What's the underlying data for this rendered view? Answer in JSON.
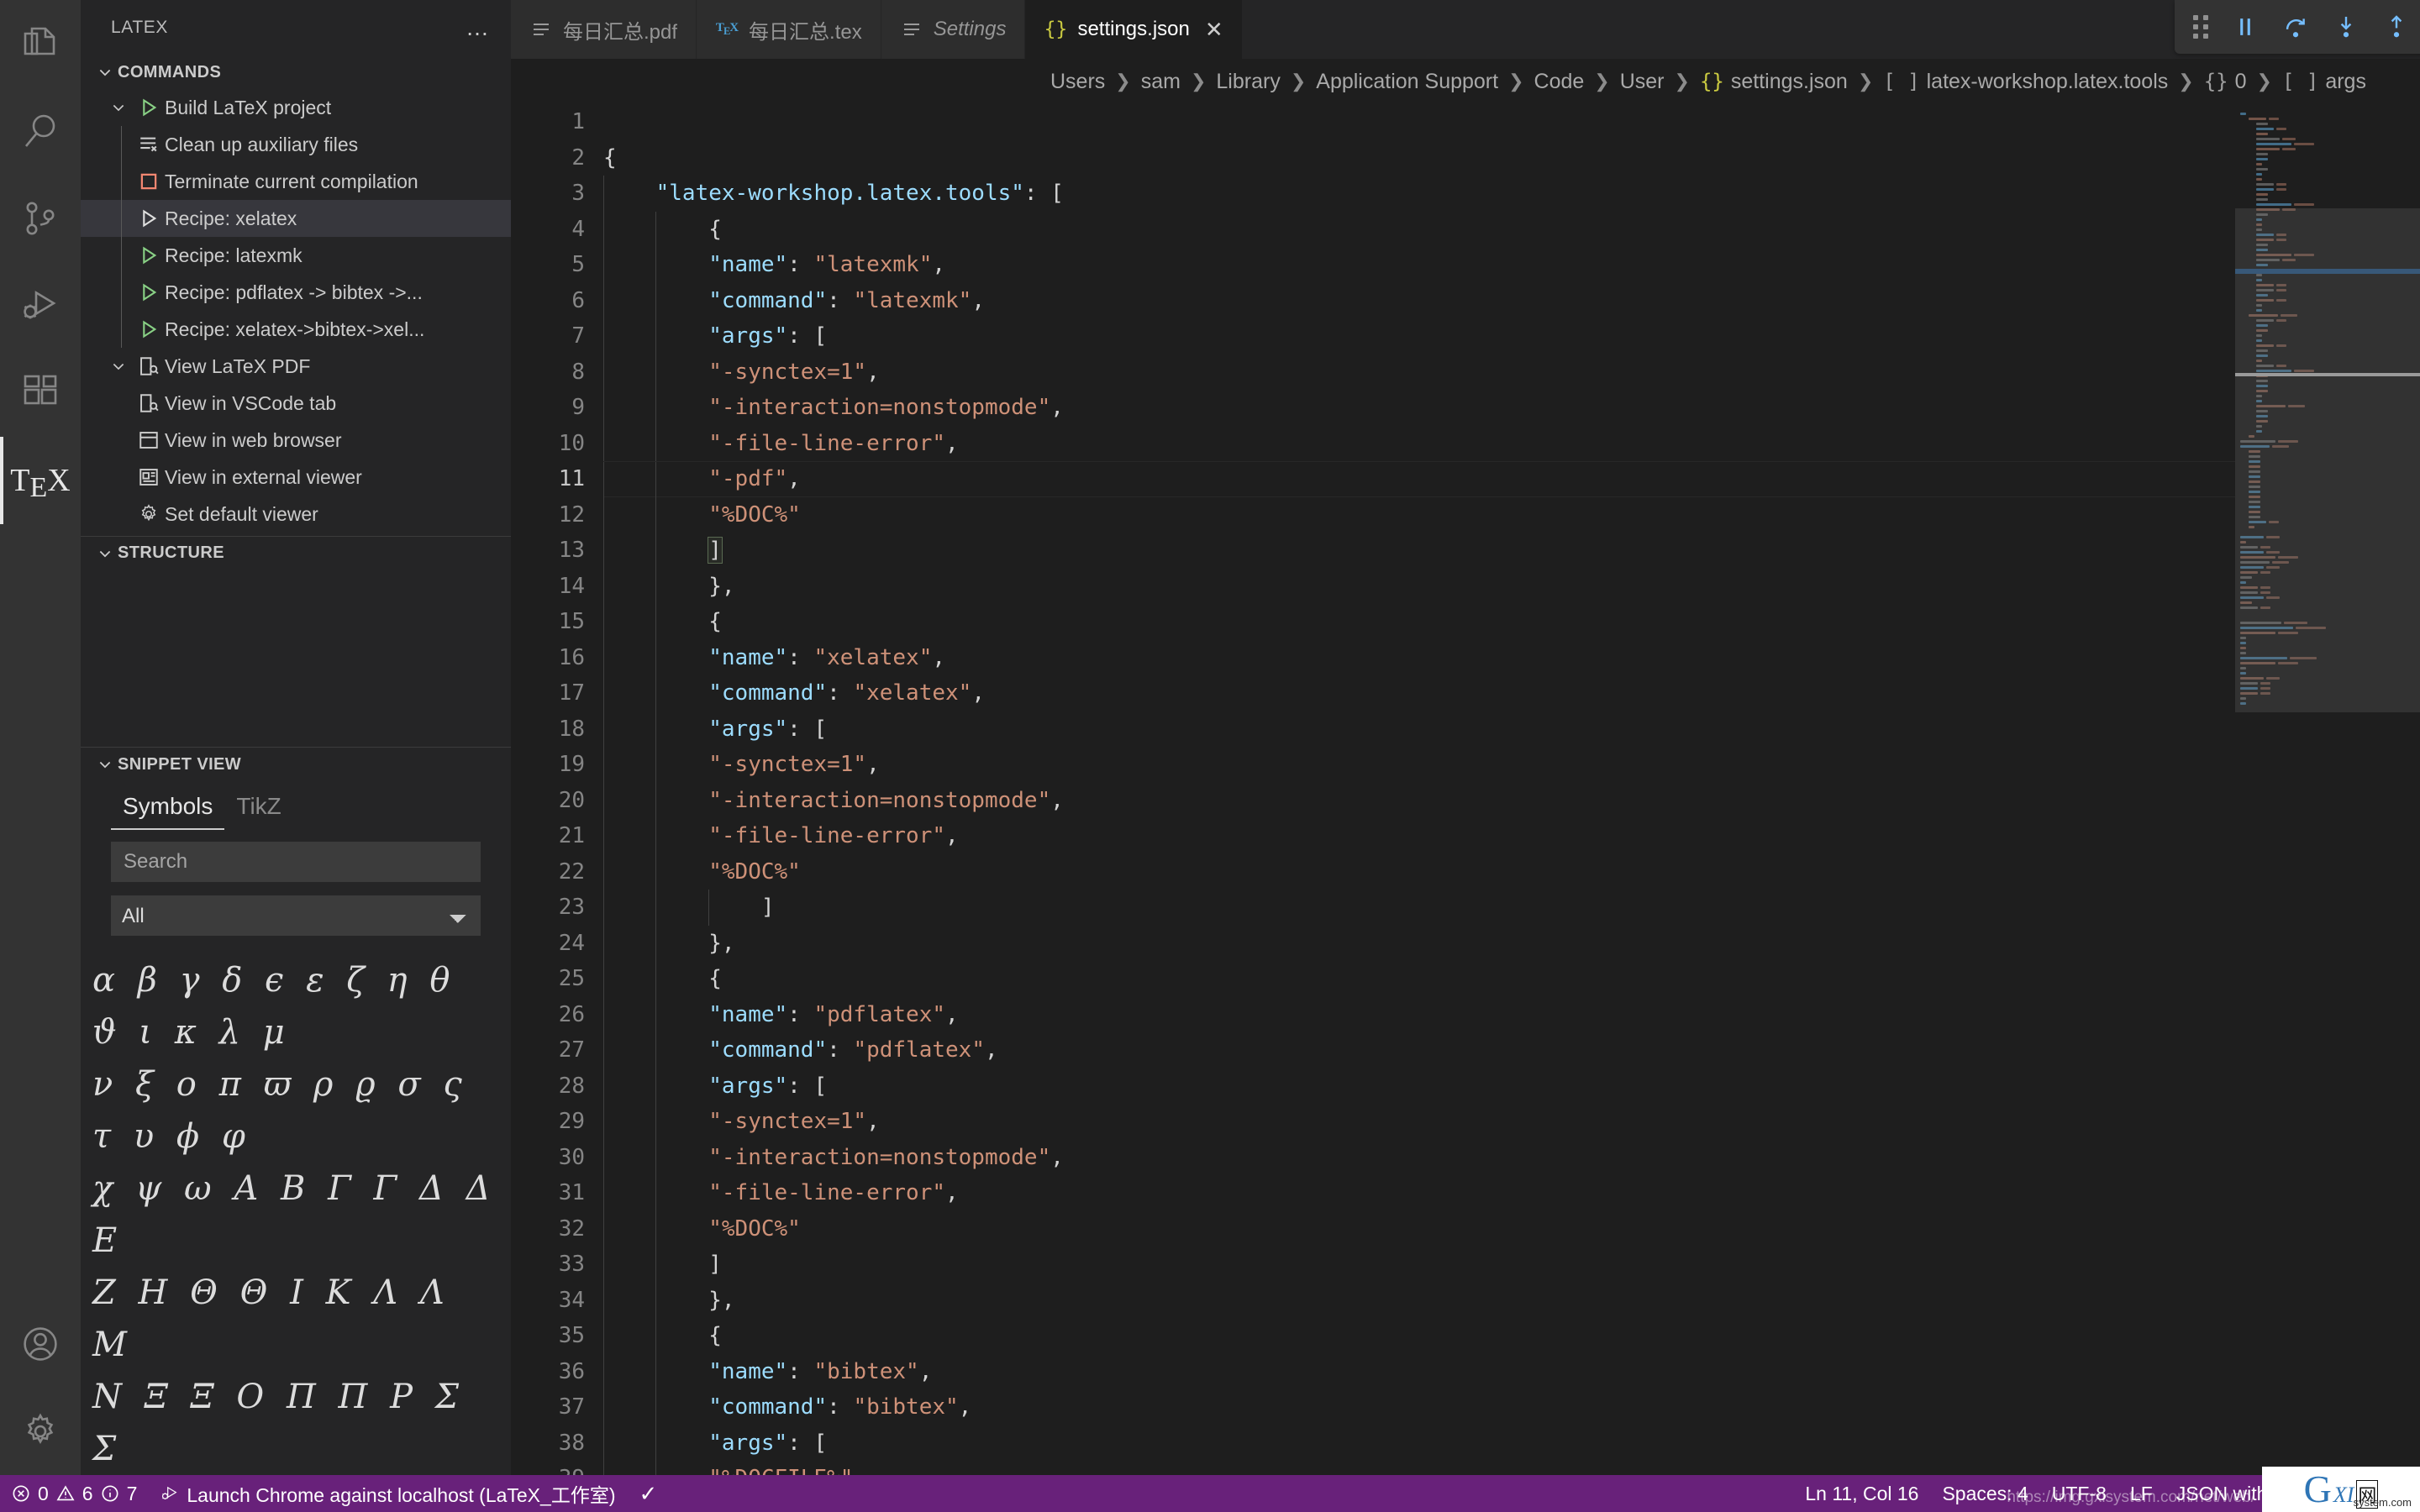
{
  "activity_bar": {
    "items": [
      {
        "name": "explorer",
        "icon": "files-icon",
        "active": false
      },
      {
        "name": "search",
        "icon": "search-icon",
        "active": false
      },
      {
        "name": "source-control",
        "icon": "source-control-icon",
        "active": false
      },
      {
        "name": "run-debug",
        "icon": "run-debug-icon",
        "active": false
      },
      {
        "name": "extensions",
        "icon": "extensions-icon",
        "active": false
      },
      {
        "name": "latex",
        "icon": "tex-icon",
        "label": "TeX",
        "active": true
      }
    ],
    "bottom": [
      {
        "name": "accounts",
        "icon": "account-icon"
      },
      {
        "name": "manage",
        "icon": "gear-icon"
      }
    ]
  },
  "sidebar": {
    "title": "LATEX",
    "more_actions": "…",
    "sections": [
      {
        "label": "COMMANDS",
        "expanded": true
      },
      {
        "label": "STRUCTURE",
        "expanded": true
      },
      {
        "label": "SNIPPET VIEW",
        "expanded": true
      }
    ],
    "commands": [
      {
        "label": "Build LaTeX project",
        "icon": "play-green-icon",
        "twisty": "chevron-down-icon",
        "depth": 1,
        "selected": false
      },
      {
        "label": "Clean up auxiliary files",
        "icon": "clear-all-icon",
        "depth": 2,
        "selected": false
      },
      {
        "label": "Terminate current compilation",
        "icon": "stop-square-icon",
        "depth": 2,
        "selected": false
      },
      {
        "label": "Recipe: xelatex",
        "icon": "play-outline-icon",
        "depth": 2,
        "selected": true
      },
      {
        "label": "Recipe: latexmk",
        "icon": "play-green-icon",
        "depth": 2,
        "selected": false
      },
      {
        "label": "Recipe: pdflatex -> bibtex ->...",
        "icon": "play-green-icon",
        "depth": 2,
        "selected": false
      },
      {
        "label": "Recipe: xelatex->bibtex->xel...",
        "icon": "play-green-icon",
        "depth": 2,
        "selected": false
      },
      {
        "label": "View LaTeX PDF",
        "icon": "preview-icon",
        "twisty": "chevron-down-icon",
        "depth": 1,
        "selected": false
      },
      {
        "label": "View in VSCode tab",
        "icon": "preview-icon",
        "depth": 2,
        "selected": false
      },
      {
        "label": "View in web browser",
        "icon": "browser-icon",
        "depth": 2,
        "selected": false
      },
      {
        "label": "View in external viewer",
        "icon": "external-viewer-icon",
        "depth": 2,
        "selected": false
      },
      {
        "label": "Set default viewer",
        "icon": "gear-icon",
        "depth": 2,
        "selected": false
      }
    ],
    "snippet": {
      "tabs": [
        {
          "label": "Symbols",
          "active": true
        },
        {
          "label": "TikZ",
          "active": false
        }
      ],
      "search_placeholder": "Search",
      "search_value": "",
      "filter_selected": "All",
      "filter_options": [
        "All"
      ],
      "symbol_rows": [
        "α β γ δ ϵ ε ζ η θ ϑ ι κ λ μ",
        "ν ξ o π ϖ ρ ϱ σ ς τ υ ϕ φ",
        "χ ψ ω A B Γ Γ Δ Δ E",
        "Z H Θ Θ I K Λ Λ M",
        "N Ξ Ξ O Π Π P Σ Σ"
      ]
    }
  },
  "tabs": [
    {
      "label": "每日汇总.pdf",
      "icon": "lines-icon",
      "active": false,
      "italic": false,
      "closable": false
    },
    {
      "label": "每日汇总.tex",
      "icon": "tex-small-icon",
      "active": false,
      "italic": false,
      "closable": false
    },
    {
      "label": "Settings",
      "icon": "lines-icon",
      "active": false,
      "italic": true,
      "closable": false
    },
    {
      "label": "settings.json",
      "icon": "json-brace-icon",
      "active": true,
      "italic": false,
      "closable": true
    }
  ],
  "tab_actions": [
    {
      "name": "open-changes-icon"
    },
    {
      "name": "split-editor-icon"
    },
    {
      "name": "more-actions-icon",
      "label": "…"
    }
  ],
  "debug_toolbar": [
    {
      "name": "drag-grip",
      "color": "#b0b0b0"
    },
    {
      "name": "pause-button",
      "color": "#75beff"
    },
    {
      "name": "step-over-button",
      "color": "#75beff"
    },
    {
      "name": "step-into-button",
      "color": "#75beff"
    },
    {
      "name": "step-out-button",
      "color": "#75beff"
    },
    {
      "name": "restart-button",
      "color": "#89d185"
    },
    {
      "name": "stop-button",
      "color": "#f48771"
    }
  ],
  "breadcrumbs": [
    {
      "label": "Users",
      "symbol": ""
    },
    {
      "label": "sam",
      "symbol": ""
    },
    {
      "label": "Library",
      "symbol": ""
    },
    {
      "label": "Application Support",
      "symbol": ""
    },
    {
      "label": "Code",
      "symbol": ""
    },
    {
      "label": "User",
      "symbol": ""
    },
    {
      "label": "settings.json",
      "symbol": "{}"
    },
    {
      "label": "latex-workshop.latex.tools",
      "symbol": "[ ]"
    },
    {
      "label": "0",
      "symbol": "{}"
    },
    {
      "label": "args",
      "symbol": "[ ]"
    }
  ],
  "editor": {
    "language": "JSON with Comments",
    "first_line": 1,
    "current_line": 11,
    "lines": [
      {
        "n": 1,
        "text": ""
      },
      {
        "n": 2,
        "text": "{"
      },
      {
        "n": 3,
        "text": "    \"latex-workshop.latex.tools\": ["
      },
      {
        "n": 4,
        "text": "        {"
      },
      {
        "n": 5,
        "text": "        \"name\": \"latexmk\","
      },
      {
        "n": 6,
        "text": "        \"command\": \"latexmk\","
      },
      {
        "n": 7,
        "text": "        \"args\": ["
      },
      {
        "n": 8,
        "text": "        \"-synctex=1\","
      },
      {
        "n": 9,
        "text": "        \"-interaction=nonstopmode\","
      },
      {
        "n": 10,
        "text": "        \"-file-line-error\","
      },
      {
        "n": 11,
        "text": "        \"-pdf\","
      },
      {
        "n": 12,
        "text": "        \"%DOC%\""
      },
      {
        "n": 13,
        "text": "        ]"
      },
      {
        "n": 14,
        "text": "        },"
      },
      {
        "n": 15,
        "text": "        {"
      },
      {
        "n": 16,
        "text": "        \"name\": \"xelatex\","
      },
      {
        "n": 17,
        "text": "        \"command\": \"xelatex\","
      },
      {
        "n": 18,
        "text": "        \"args\": ["
      },
      {
        "n": 19,
        "text": "        \"-synctex=1\","
      },
      {
        "n": 20,
        "text": "        \"-interaction=nonstopmode\","
      },
      {
        "n": 21,
        "text": "        \"-file-line-error\","
      },
      {
        "n": 22,
        "text": "        \"%DOC%\""
      },
      {
        "n": 23,
        "text": "            ]"
      },
      {
        "n": 24,
        "text": "        },"
      },
      {
        "n": 25,
        "text": "        {"
      },
      {
        "n": 26,
        "text": "        \"name\": \"pdflatex\","
      },
      {
        "n": 27,
        "text": "        \"command\": \"pdflatex\","
      },
      {
        "n": 28,
        "text": "        \"args\": ["
      },
      {
        "n": 29,
        "text": "        \"-synctex=1\","
      },
      {
        "n": 30,
        "text": "        \"-interaction=nonstopmode\","
      },
      {
        "n": 31,
        "text": "        \"-file-line-error\","
      },
      {
        "n": 32,
        "text": "        \"%DOC%\""
      },
      {
        "n": 33,
        "text": "        ]"
      },
      {
        "n": 34,
        "text": "        },"
      },
      {
        "n": 35,
        "text": "        {"
      },
      {
        "n": 36,
        "text": "        \"name\": \"bibtex\","
      },
      {
        "n": 37,
        "text": "        \"command\": \"bibtex\","
      },
      {
        "n": 38,
        "text": "        \"args\": ["
      },
      {
        "n": 39,
        "text": "        \"%DOCFILE%\""
      }
    ]
  },
  "status_bar": {
    "errors": "0",
    "warnings": "6",
    "infos": "7",
    "debug_target": "Launch Chrome against localhost (LaTeX_工作室)",
    "check": "✓",
    "position": "Ln 11, Col 16",
    "indent": "Spaces: 4",
    "encoding": "UTF-8",
    "eol": "LF",
    "language": "JSON with Comments",
    "bell": "notifications-icon",
    "background": "#68217a"
  },
  "watermark": {
    "letter": "G",
    "xi": "XI",
    "cn": "网",
    "domain": "system.com",
    "url": "https://img.gxisystem.com/net/web/"
  },
  "colors": {
    "editor_bg": "#1e1e1e",
    "sidebar_bg": "#252526",
    "activitybar_bg": "#333333",
    "tab_active_bg": "#1e1e1e",
    "tab_inactive_bg": "#2d2d2d",
    "status_bg": "#68217a",
    "key": "#9cdcfe",
    "string": "#ce9178",
    "punct": "#d4d4d4",
    "selection": "#37373d",
    "green": "#89d185",
    "red": "#f48771",
    "blue": "#75beff",
    "yellow": "#cbcb41"
  }
}
